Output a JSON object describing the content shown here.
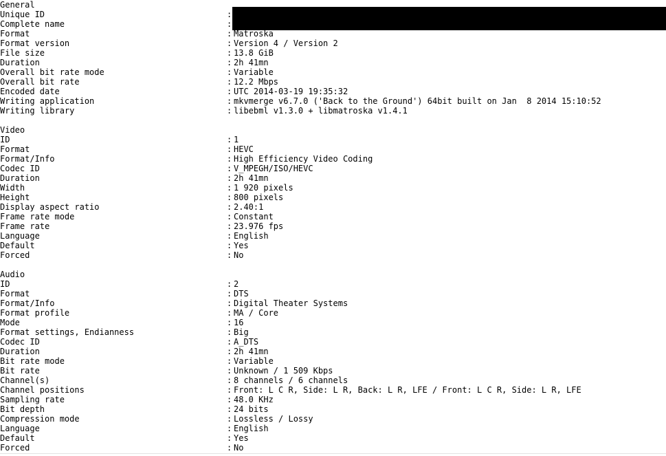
{
  "app": {
    "title": "MediaInfo",
    "redaction_color": "#000000",
    "background_color": "#ffffff",
    "text_color": "#000000",
    "rule_color": "#e3e3e3"
  },
  "sections": [
    {
      "name": "General",
      "heading": "General",
      "rows": [
        {
          "label": "Unique ID",
          "separator": ":",
          "value": "",
          "redacted": true
        },
        {
          "label": "Complete name",
          "separator": ":",
          "value": "",
          "redacted": true
        },
        {
          "label": "Format",
          "separator": ":",
          "value": "Matroska"
        },
        {
          "label": "Format version",
          "separator": ":",
          "value": "Version 4 / Version 2"
        },
        {
          "label": "File size",
          "separator": ":",
          "value": "13.8 GiB"
        },
        {
          "label": "Duration",
          "separator": ":",
          "value": "2h 41mn"
        },
        {
          "label": "Overall bit rate mode",
          "separator": ":",
          "value": "Variable"
        },
        {
          "label": "Overall bit rate",
          "separator": ":",
          "value": "12.2 Mbps"
        },
        {
          "label": "Encoded date",
          "separator": ":",
          "value": "UTC 2014-03-19 19:35:32"
        },
        {
          "label": "Writing application",
          "separator": ":",
          "value": "mkvmerge v6.7.0 ('Back to the Ground') 64bit built on Jan  8 2014 15:10:52"
        },
        {
          "label": "Writing library",
          "separator": ":",
          "value": "libebml v1.3.0 + libmatroska v1.4.1"
        }
      ]
    },
    {
      "name": "Video",
      "heading": "Video",
      "rows": [
        {
          "label": "ID",
          "separator": ":",
          "value": "1"
        },
        {
          "label": "Format",
          "separator": ":",
          "value": "HEVC"
        },
        {
          "label": "Format/Info",
          "separator": ":",
          "value": "High Efficiency Video Coding"
        },
        {
          "label": "Codec ID",
          "separator": ":",
          "value": "V_MPEGH/ISO/HEVC"
        },
        {
          "label": "Duration",
          "separator": ":",
          "value": "2h 41mn"
        },
        {
          "label": "Width",
          "separator": ":",
          "value": "1 920 pixels"
        },
        {
          "label": "Height",
          "separator": ":",
          "value": "800 pixels"
        },
        {
          "label": "Display aspect ratio",
          "separator": ":",
          "value": "2.40:1"
        },
        {
          "label": "Frame rate mode",
          "separator": ":",
          "value": "Constant"
        },
        {
          "label": "Frame rate",
          "separator": ":",
          "value": "23.976 fps"
        },
        {
          "label": "Language",
          "separator": ":",
          "value": "English"
        },
        {
          "label": "Default",
          "separator": ":",
          "value": "Yes"
        },
        {
          "label": "Forced",
          "separator": ":",
          "value": "No"
        }
      ]
    },
    {
      "name": "Audio",
      "heading": "Audio",
      "rows": [
        {
          "label": "ID",
          "separator": ":",
          "value": "2"
        },
        {
          "label": "Format",
          "separator": ":",
          "value": "DTS"
        },
        {
          "label": "Format/Info",
          "separator": ":",
          "value": "Digital Theater Systems"
        },
        {
          "label": "Format profile",
          "separator": ":",
          "value": "MA / Core"
        },
        {
          "label": "Mode",
          "separator": ":",
          "value": "16"
        },
        {
          "label": "Format settings, Endianness",
          "separator": ":",
          "value": "Big"
        },
        {
          "label": "Codec ID",
          "separator": ":",
          "value": "A_DTS"
        },
        {
          "label": "Duration",
          "separator": ":",
          "value": "2h 41mn"
        },
        {
          "label": "Bit rate mode",
          "separator": ":",
          "value": "Variable"
        },
        {
          "label": "Bit rate",
          "separator": ":",
          "value": "Unknown / 1 509 Kbps"
        },
        {
          "label": "Channel(s)",
          "separator": ":",
          "value": "8 channels / 6 channels"
        },
        {
          "label": "Channel positions",
          "separator": ":",
          "value": "Front: L C R, Side: L R, Back: L R, LFE / Front: L C R, Side: L R, LFE"
        },
        {
          "label": "Sampling rate",
          "separator": ":",
          "value": "48.0 KHz"
        },
        {
          "label": "Bit depth",
          "separator": ":",
          "value": "24 bits"
        },
        {
          "label": "Compression mode",
          "separator": ":",
          "value": "Lossless / Lossy"
        },
        {
          "label": "Language",
          "separator": ":",
          "value": "English"
        },
        {
          "label": "Default",
          "separator": ":",
          "value": "Yes"
        },
        {
          "label": "Forced",
          "separator": ":",
          "value": "No"
        }
      ]
    }
  ]
}
